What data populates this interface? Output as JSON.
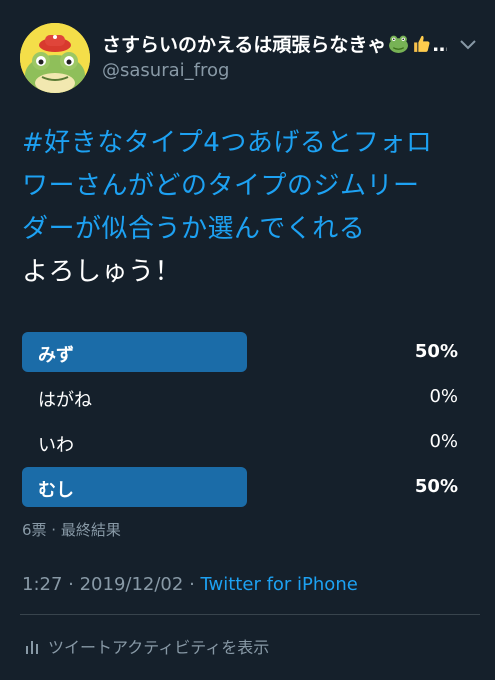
{
  "user": {
    "display_name": "さすらいのかえるは頑張らなきゃ",
    "ellipsis": "…",
    "handle": "@sasurai_frog"
  },
  "tweet": {
    "hashtag_line1": "#好きなタイプ4つあげるとフォロ",
    "hashtag_line2": "ワーさんがどのタイプのジムリー",
    "hashtag_line3": "ダーが似合うか選んでくれる",
    "text_line": "よろしゅう！"
  },
  "poll": {
    "options": [
      {
        "label": "みず",
        "percent": "50%",
        "value": 0.5,
        "winner": true
      },
      {
        "label": "はがね",
        "percent": "0%",
        "value": 0,
        "winner": false
      },
      {
        "label": "いわ",
        "percent": "0%",
        "value": 0,
        "winner": false
      },
      {
        "label": "むし",
        "percent": "50%",
        "value": 0.5,
        "winner": true
      }
    ],
    "summary": "6票 · 最終結果"
  },
  "meta": {
    "time": "1:27",
    "separator1": " · ",
    "date": "2019/12/02",
    "separator2": " · ",
    "source": "Twitter for iPhone"
  },
  "activity": {
    "label": "ツイートアクティビティを表示"
  },
  "colors": {
    "background": "#15202b",
    "accent": "#1da1f2",
    "poll_bar": "#1b6ca8",
    "muted": "#8899a6"
  },
  "icons": {
    "caret": "chevron-down-icon",
    "activity": "bar-chart-icon",
    "emoji1": "frog-emoji",
    "emoji2": "thumbs-up-emoji"
  }
}
